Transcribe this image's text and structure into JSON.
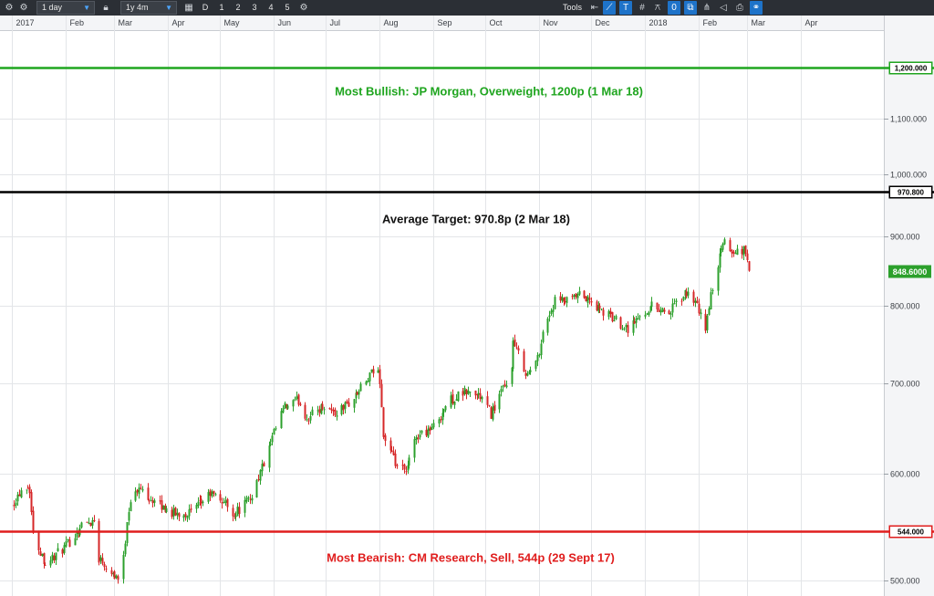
{
  "toolbar": {
    "interval": "1 day",
    "range": "1y 4m",
    "period_d": "D",
    "periods": [
      "1",
      "2",
      "3",
      "4",
      "5"
    ],
    "tools_label": "Tools",
    "icons": [
      "settings-icon",
      "lock-icon",
      "calendar-icon",
      "settings-icon",
      "arrow-left-icon",
      "trendline-icon",
      "text-tool-icon",
      "grid-icon",
      "fibonacci-icon",
      "zero-icon",
      "indicator-icon",
      "draw-icon",
      "eraser-icon",
      "print-icon",
      "link-icon"
    ]
  },
  "chart_data": {
    "type": "candlestick",
    "title": "",
    "x_tick_labels": [
      "2017",
      "Feb",
      "Mar",
      "Apr",
      "May",
      "Jun",
      "Jul",
      "Aug",
      "Sep",
      "Oct",
      "Nov",
      "Dec",
      "2018",
      "Feb",
      "Mar",
      "Apr"
    ],
    "y_tick_labels": [
      "1,100.000",
      "1,000.000",
      "900.000",
      "800.000",
      "700.000",
      "600.000",
      "500.000"
    ],
    "y_ticks": [
      1100,
      1000,
      900,
      800,
      700,
      600,
      500
    ],
    "y_scale": "log",
    "ylim": [
      487,
      1280
    ],
    "grid": true,
    "current_price_label": "848.6000",
    "current_price": 848.6,
    "up_color": "#2ca02c",
    "down_color": "#d62728",
    "reference_lines": [
      {
        "value": 1200,
        "label": "1,200.000",
        "color": "#1fa51f",
        "annotation": "Most Bullish: JP Morgan, Overweight, 1200p (1 Mar 18)"
      },
      {
        "value": 970.8,
        "label": "970.800",
        "color": "#000000",
        "annotation": "Average Target: 970.8p (2 Mar 18)"
      },
      {
        "value": 544,
        "label": "544.000",
        "color": "#e01e1e",
        "annotation": "Most Bearish: CM Research, Sell, 544p (29 Sept 17)"
      }
    ],
    "price_path": [
      {
        "date": "2017-01-01",
        "close": 570
      },
      {
        "date": "2017-01-08",
        "close": 590
      },
      {
        "date": "2017-01-11",
        "close": 585
      },
      {
        "date": "2017-01-13",
        "close": 540
      },
      {
        "date": "2017-01-20",
        "close": 515
      },
      {
        "date": "2017-02-01",
        "close": 530
      },
      {
        "date": "2017-02-10",
        "close": 550
      },
      {
        "date": "2017-02-18",
        "close": 555
      },
      {
        "date": "2017-02-20",
        "close": 520
      },
      {
        "date": "2017-03-01",
        "close": 505
      },
      {
        "date": "2017-03-05",
        "close": 500
      },
      {
        "date": "2017-03-08",
        "close": 555
      },
      {
        "date": "2017-03-10",
        "close": 575
      },
      {
        "date": "2017-03-16",
        "close": 585
      },
      {
        "date": "2017-03-25",
        "close": 570
      },
      {
        "date": "2017-04-05",
        "close": 560
      },
      {
        "date": "2017-04-15",
        "close": 562
      },
      {
        "date": "2017-04-25",
        "close": 580
      },
      {
        "date": "2017-05-03",
        "close": 572
      },
      {
        "date": "2017-05-09",
        "close": 560
      },
      {
        "date": "2017-05-18",
        "close": 575
      },
      {
        "date": "2017-05-28",
        "close": 620
      },
      {
        "date": "2017-06-06",
        "close": 670
      },
      {
        "date": "2017-06-15",
        "close": 680
      },
      {
        "date": "2017-06-20",
        "close": 660
      },
      {
        "date": "2017-06-30",
        "close": 675
      },
      {
        "date": "2017-07-06",
        "close": 665
      },
      {
        "date": "2017-07-16",
        "close": 680
      },
      {
        "date": "2017-07-25",
        "close": 705
      },
      {
        "date": "2017-07-30",
        "close": 720
      },
      {
        "date": "2017-08-01",
        "close": 705
      },
      {
        "date": "2017-08-03",
        "close": 640
      },
      {
        "date": "2017-08-10",
        "close": 610
      },
      {
        "date": "2017-08-16",
        "close": 600
      },
      {
        "date": "2017-08-22",
        "close": 640
      },
      {
        "date": "2017-09-01",
        "close": 650
      },
      {
        "date": "2017-09-10",
        "close": 680
      },
      {
        "date": "2017-09-20",
        "close": 690
      },
      {
        "date": "2017-09-28",
        "close": 685
      },
      {
        "date": "2017-10-04",
        "close": 665
      },
      {
        "date": "2017-10-10",
        "close": 690
      },
      {
        "date": "2017-10-15",
        "close": 700
      },
      {
        "date": "2017-10-17",
        "close": 750
      },
      {
        "date": "2017-10-25",
        "close": 710
      },
      {
        "date": "2017-10-31",
        "close": 730
      },
      {
        "date": "2017-11-03",
        "close": 765
      },
      {
        "date": "2017-11-10",
        "close": 805
      },
      {
        "date": "2017-11-18",
        "close": 805
      },
      {
        "date": "2017-11-25",
        "close": 815
      },
      {
        "date": "2017-12-05",
        "close": 795
      },
      {
        "date": "2017-12-15",
        "close": 780
      },
      {
        "date": "2017-12-22",
        "close": 770
      },
      {
        "date": "2017-12-27",
        "close": 780
      },
      {
        "date": "2018-01-05",
        "close": 800
      },
      {
        "date": "2018-01-15",
        "close": 790
      },
      {
        "date": "2018-01-22",
        "close": 810
      },
      {
        "date": "2018-01-27",
        "close": 820
      },
      {
        "date": "2018-02-01",
        "close": 790
      },
      {
        "date": "2018-02-05",
        "close": 770
      },
      {
        "date": "2018-02-10",
        "close": 840
      },
      {
        "date": "2018-02-16",
        "close": 895
      },
      {
        "date": "2018-02-20",
        "close": 875
      },
      {
        "date": "2018-02-27",
        "close": 880
      },
      {
        "date": "2018-03-02",
        "close": 848.6
      }
    ]
  }
}
